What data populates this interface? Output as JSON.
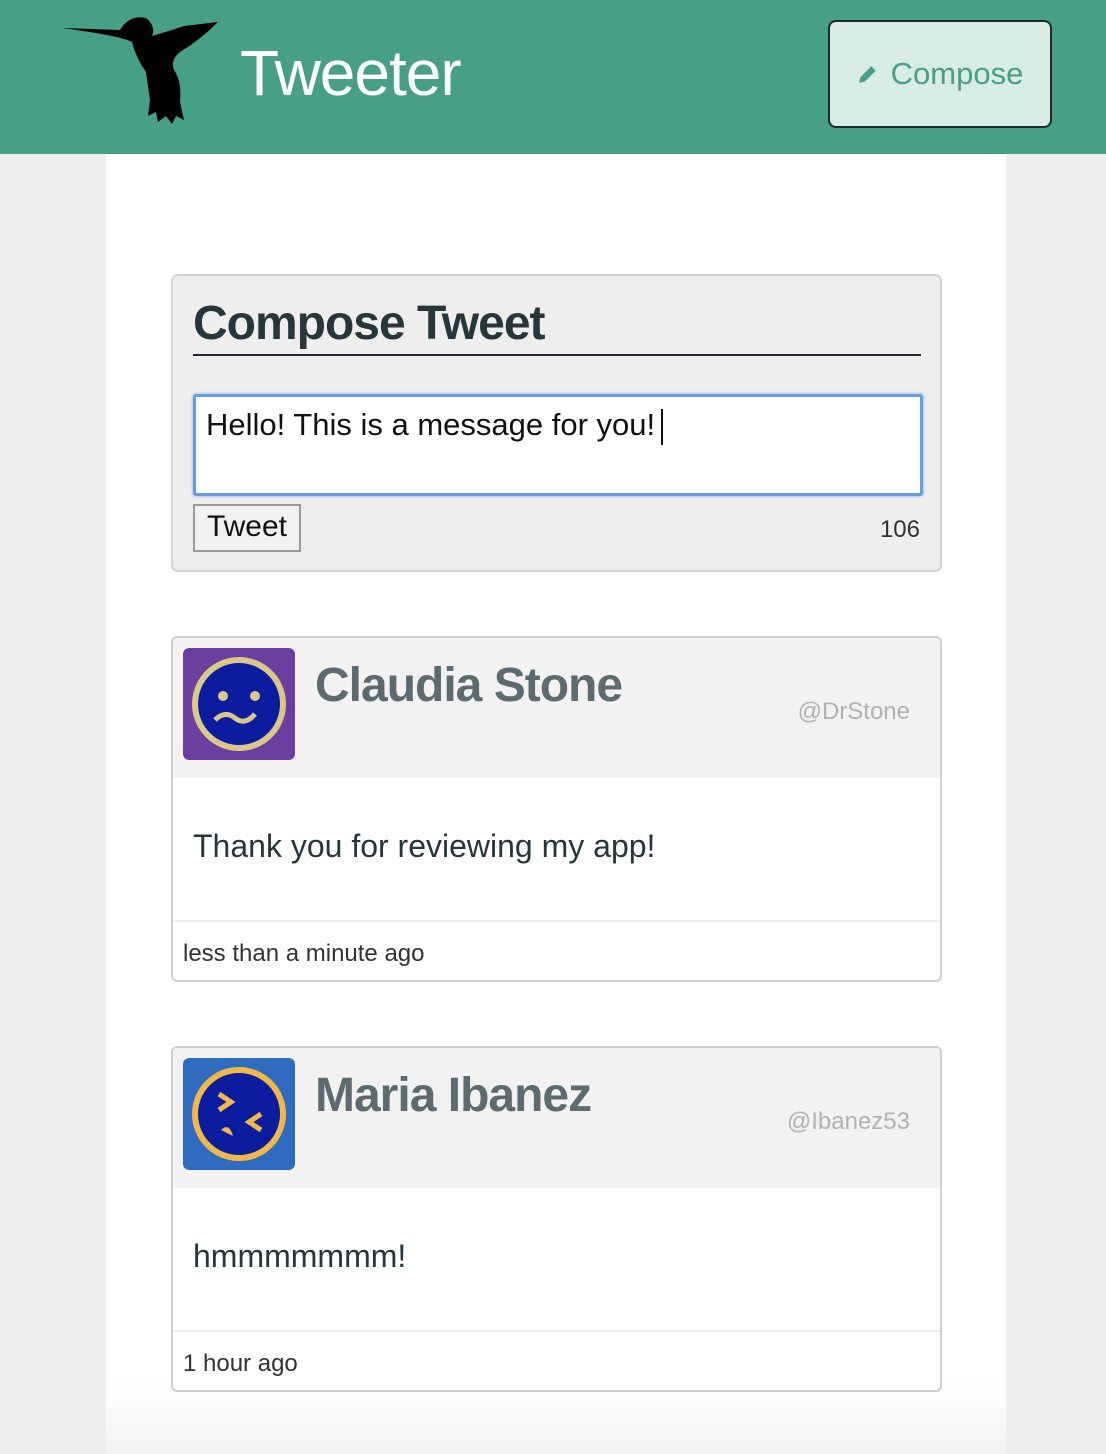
{
  "nav": {
    "brand": "Tweeter",
    "compose_label": "Compose"
  },
  "compose": {
    "title": "Compose Tweet",
    "input_value": "Hello! This is a message for you!",
    "tweet_button": "Tweet",
    "char_count": "106"
  },
  "tweets": [
    {
      "name": "Claudia Stone",
      "handle": "@DrStone",
      "text": "Thank you for reviewing my app!",
      "time": "less than a minute ago",
      "avatar_color": "#6b3fa0"
    },
    {
      "name": "Maria Ibanez",
      "handle": "@Ibanez53",
      "text": "hmmmmmmm!",
      "time": "1 hour ago",
      "avatar_color": "#2f6cc0"
    }
  ],
  "colors": {
    "accent": "#479f88",
    "title": "#26373c"
  },
  "icons": {
    "logo": "hummingbird-icon",
    "compose": "pencil-icon"
  }
}
